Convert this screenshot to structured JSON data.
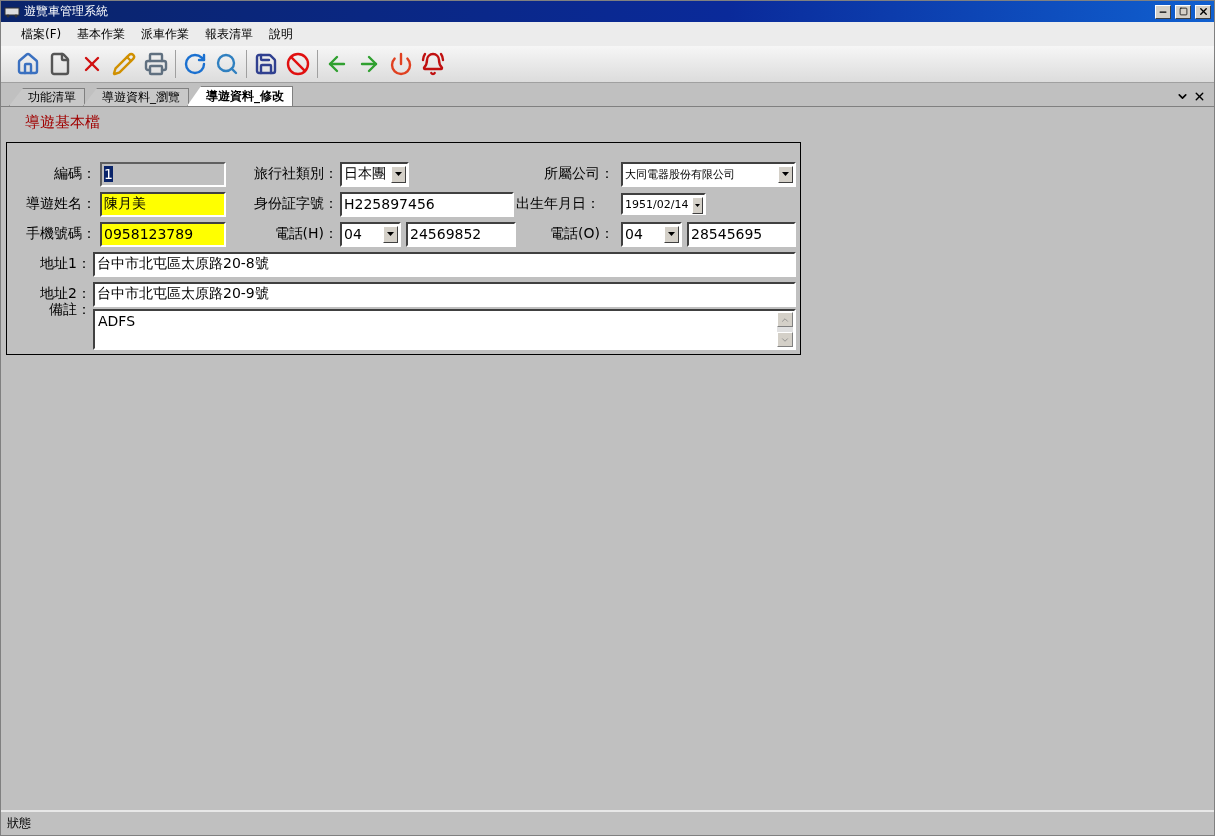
{
  "window": {
    "title": "遊覽車管理系統"
  },
  "menu": [
    {
      "label": "檔案(F)"
    },
    {
      "label": "基本作業"
    },
    {
      "label": "派車作業"
    },
    {
      "label": "報表清單"
    },
    {
      "label": "說明"
    }
  ],
  "tabs": [
    {
      "label": "功能清單",
      "selected": false
    },
    {
      "label": "導遊資料_瀏覽",
      "selected": false
    },
    {
      "label": "導遊資料_修改",
      "selected": true
    }
  ],
  "section_title": "導遊基本檔",
  "form_rows": [
    [
      {
        "kind": "label",
        "text": "編碼："
      },
      {
        "kind": "text",
        "value": "1",
        "highlighted": false,
        "readonly": true,
        "text_selected": true
      },
      {
        "kind": "label",
        "text": "旅行社類別："
      },
      {
        "kind": "combo",
        "value": "日本團",
        "highlighted": false,
        "readonly": false,
        "text_selected": false
      },
      {
        "kind": "label",
        "text": "所屬公司："
      },
      {
        "kind": "combo",
        "value": "大同電器股份有限公司",
        "highlighted": false,
        "readonly": false,
        "text_selected": false
      }
    ],
    [
      {
        "kind": "label",
        "text": "導遊姓名："
      },
      {
        "kind": "text",
        "value": "陳月美",
        "highlighted": true,
        "readonly": false,
        "text_selected": false
      },
      {
        "kind": "label",
        "text": "身份証字號："
      },
      {
        "kind": "text",
        "value": "H225897456",
        "highlighted": false,
        "readonly": false,
        "text_selected": false
      },
      {
        "kind": "label",
        "text": "出生年月日："
      },
      {
        "kind": "date",
        "value": "1951/02/14",
        "highlighted": false,
        "readonly": false,
        "text_selected": false
      }
    ],
    [
      {
        "kind": "label",
        "text": "手機號碼："
      },
      {
        "kind": "text",
        "value": "0958123789",
        "highlighted": true,
        "readonly": false,
        "text_selected": false
      },
      {
        "kind": "label",
        "text": "電話(H)："
      },
      {
        "kind": "combo",
        "value": "04",
        "highlighted": false,
        "readonly": false,
        "text_selected": false
      },
      {
        "kind": "text",
        "value": "24569852",
        "highlighted": false,
        "readonly": false,
        "text_selected": false
      },
      {
        "kind": "label",
        "text": "電話(O)："
      },
      {
        "kind": "combo",
        "value": "04",
        "highlighted": false,
        "readonly": false,
        "text_selected": false
      },
      {
        "kind": "text",
        "value": "28545695",
        "highlighted": false,
        "readonly": false,
        "text_selected": false
      }
    ],
    [
      {
        "kind": "label",
        "text": "地址1："
      },
      {
        "kind": "text",
        "value": "台中市北屯區太原路20-8號",
        "highlighted": false,
        "readonly": false,
        "text_selected": false
      }
    ],
    [
      {
        "kind": "label",
        "text": "地址2："
      },
      {
        "kind": "text",
        "value": "台中市北屯區太原路20-9號",
        "highlighted": false,
        "readonly": false,
        "text_selected": false
      }
    ],
    [
      {
        "kind": "label",
        "text": "備註："
      },
      {
        "kind": "textarea",
        "value": "ADFS",
        "highlighted": false,
        "readonly": false,
        "text_selected": false
      }
    ]
  ],
  "status_bar": "狀態"
}
